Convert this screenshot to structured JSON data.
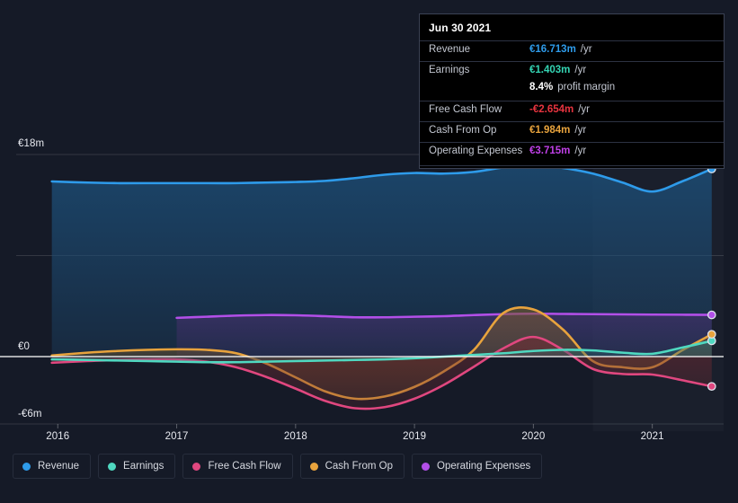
{
  "axes": {
    "y_ticks": [
      {
        "label": "€18m",
        "value": 18
      },
      {
        "label": "€0",
        "value": 0
      },
      {
        "label": "-€6m",
        "value": -6
      }
    ],
    "x_ticks": [
      "2016",
      "2017",
      "2018",
      "2019",
      "2020",
      "2021"
    ]
  },
  "tooltip": {
    "date": "Jun 30 2021",
    "rows": [
      {
        "key": "Revenue",
        "value": "€16.713m",
        "unit": "/yr",
        "color": "#2e9bea"
      },
      {
        "key": "Earnings",
        "value": "€1.403m",
        "unit": "/yr",
        "color": "#34d5b4"
      },
      {
        "key": "Free Cash Flow",
        "value": "-€2.654m",
        "unit": "/yr",
        "color": "#e8343f"
      },
      {
        "key": "Cash From Op",
        "value": "€1.984m",
        "unit": "/yr",
        "color": "#e8a33d"
      },
      {
        "key": "Operating Expenses",
        "value": "€3.715m",
        "unit": "/yr",
        "color": "#c040e8"
      }
    ],
    "margin": {
      "key": "",
      "value": "8.4%",
      "unit": "profit margin"
    }
  },
  "legend": [
    {
      "label": "Revenue",
      "color": "#2e9bea"
    },
    {
      "label": "Earnings",
      "color": "#4fd8c0"
    },
    {
      "label": "Free Cash Flow",
      "color": "#e0477f"
    },
    {
      "label": "Cash From Op",
      "color": "#e8a33d"
    },
    {
      "label": "Operating Expenses",
      "color": "#b24fe8"
    }
  ],
  "chart_data": {
    "type": "area",
    "title": "",
    "xlabel": "",
    "ylabel": "",
    "currency": "EUR",
    "units": "millions per year",
    "xlim": [
      2015.65,
      2021.6
    ],
    "ylim": [
      -6.6,
      19.2
    ],
    "grid": true,
    "legend_position": "bottom",
    "forecast_start_x": 2020.5,
    "x": [
      2015.95,
      2016.25,
      2016.5,
      2016.75,
      2017.0,
      2017.25,
      2017.5,
      2017.75,
      2018.0,
      2018.25,
      2018.5,
      2018.75,
      2019.0,
      2019.25,
      2019.5,
      2019.75,
      2020.0,
      2020.25,
      2020.5,
      2020.75,
      2021.0,
      2021.25,
      2021.5
    ],
    "series": [
      {
        "name": "Revenue",
        "color": "#2e9bea",
        "fill": "#1d4f79",
        "values": [
          15.6,
          15.5,
          15.45,
          15.45,
          15.45,
          15.45,
          15.45,
          15.5,
          15.55,
          15.65,
          15.9,
          16.2,
          16.35,
          16.3,
          16.45,
          16.85,
          17.05,
          16.8,
          16.3,
          15.5,
          14.7,
          15.6,
          16.713
        ]
      },
      {
        "name": "Earnings",
        "color": "#4fd8c0",
        "fill": "#2a6a6f",
        "values": [
          -0.25,
          -0.3,
          -0.35,
          -0.4,
          -0.45,
          -0.5,
          -0.5,
          -0.45,
          -0.4,
          -0.35,
          -0.3,
          -0.25,
          -0.15,
          0.0,
          0.15,
          0.3,
          0.5,
          0.6,
          0.55,
          0.35,
          0.25,
          0.8,
          1.403
        ]
      },
      {
        "name": "Free Cash Flow",
        "color": "#e0477f",
        "fill": "#6e2b33",
        "values": [
          -0.55,
          -0.4,
          -0.3,
          -0.25,
          -0.25,
          -0.45,
          -0.95,
          -1.8,
          -2.85,
          -3.95,
          -4.6,
          -4.5,
          -3.75,
          -2.5,
          -0.9,
          0.75,
          1.75,
          0.6,
          -1.1,
          -1.55,
          -1.6,
          -2.1,
          -2.654
        ]
      },
      {
        "name": "Cash From Op",
        "color": "#e8a33d",
        "fill": "#7a5a2a",
        "values": [
          0.1,
          0.35,
          0.5,
          0.6,
          0.65,
          0.6,
          0.3,
          -0.6,
          -1.85,
          -3.1,
          -3.75,
          -3.55,
          -2.7,
          -1.3,
          0.6,
          3.9,
          4.2,
          2.4,
          -0.4,
          -0.95,
          -0.95,
          0.55,
          1.984
        ]
      },
      {
        "name": "Operating Expenses",
        "color": "#b24fe8",
        "fill": "#4a3070",
        "start_x": 2017.0,
        "values": [
          null,
          null,
          null,
          null,
          3.45,
          3.55,
          3.65,
          3.7,
          3.68,
          3.6,
          3.5,
          3.5,
          3.55,
          3.6,
          3.7,
          3.78,
          3.82,
          3.8,
          3.78,
          3.76,
          3.74,
          3.73,
          3.715
        ]
      }
    ]
  }
}
